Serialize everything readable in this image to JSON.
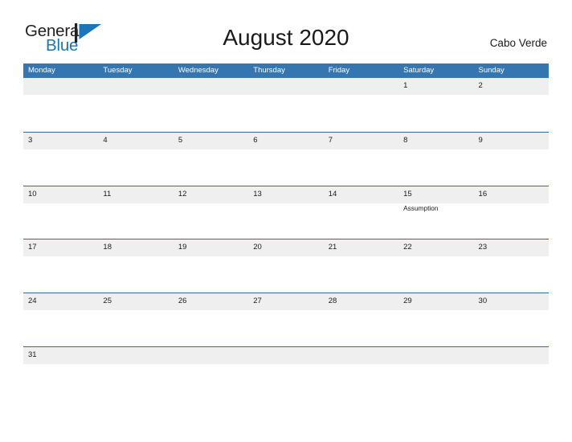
{
  "brand": {
    "name_part1": "General",
    "name_part2": "Blue",
    "logo_icon": "flag-triangle-icon",
    "color_dark": "#231f20",
    "color_blue": "#1b75bb"
  },
  "header": {
    "title": "August 2020",
    "region": "Cabo Verde"
  },
  "theme": {
    "header_blue": "#3575b0",
    "row_border": "#2c6ca5",
    "strip_gray": "#efefef",
    "text_dark": "#1a1a1a"
  },
  "calendar": {
    "weekdays": [
      "Monday",
      "Tuesday",
      "Wednesday",
      "Thursday",
      "Friday",
      "Saturday",
      "Sunday"
    ],
    "weeks": [
      [
        {
          "day": "",
          "event": ""
        },
        {
          "day": "",
          "event": ""
        },
        {
          "day": "",
          "event": ""
        },
        {
          "day": "",
          "event": ""
        },
        {
          "day": "",
          "event": ""
        },
        {
          "day": "1",
          "event": ""
        },
        {
          "day": "2",
          "event": ""
        }
      ],
      [
        {
          "day": "3",
          "event": ""
        },
        {
          "day": "4",
          "event": ""
        },
        {
          "day": "5",
          "event": ""
        },
        {
          "day": "6",
          "event": ""
        },
        {
          "day": "7",
          "event": ""
        },
        {
          "day": "8",
          "event": ""
        },
        {
          "day": "9",
          "event": ""
        }
      ],
      [
        {
          "day": "10",
          "event": ""
        },
        {
          "day": "11",
          "event": ""
        },
        {
          "day": "12",
          "event": ""
        },
        {
          "day": "13",
          "event": ""
        },
        {
          "day": "14",
          "event": ""
        },
        {
          "day": "15",
          "event": "Assumption"
        },
        {
          "day": "16",
          "event": ""
        }
      ],
      [
        {
          "day": "17",
          "event": ""
        },
        {
          "day": "18",
          "event": ""
        },
        {
          "day": "19",
          "event": ""
        },
        {
          "day": "20",
          "event": ""
        },
        {
          "day": "21",
          "event": ""
        },
        {
          "day": "22",
          "event": ""
        },
        {
          "day": "23",
          "event": ""
        }
      ],
      [
        {
          "day": "24",
          "event": ""
        },
        {
          "day": "25",
          "event": ""
        },
        {
          "day": "26",
          "event": ""
        },
        {
          "day": "27",
          "event": ""
        },
        {
          "day": "28",
          "event": ""
        },
        {
          "day": "29",
          "event": ""
        },
        {
          "day": "30",
          "event": ""
        }
      ],
      [
        {
          "day": "31",
          "event": ""
        },
        {
          "day": "",
          "event": ""
        },
        {
          "day": "",
          "event": ""
        },
        {
          "day": "",
          "event": ""
        },
        {
          "day": "",
          "event": ""
        },
        {
          "day": "",
          "event": ""
        },
        {
          "day": "",
          "event": ""
        }
      ]
    ]
  }
}
